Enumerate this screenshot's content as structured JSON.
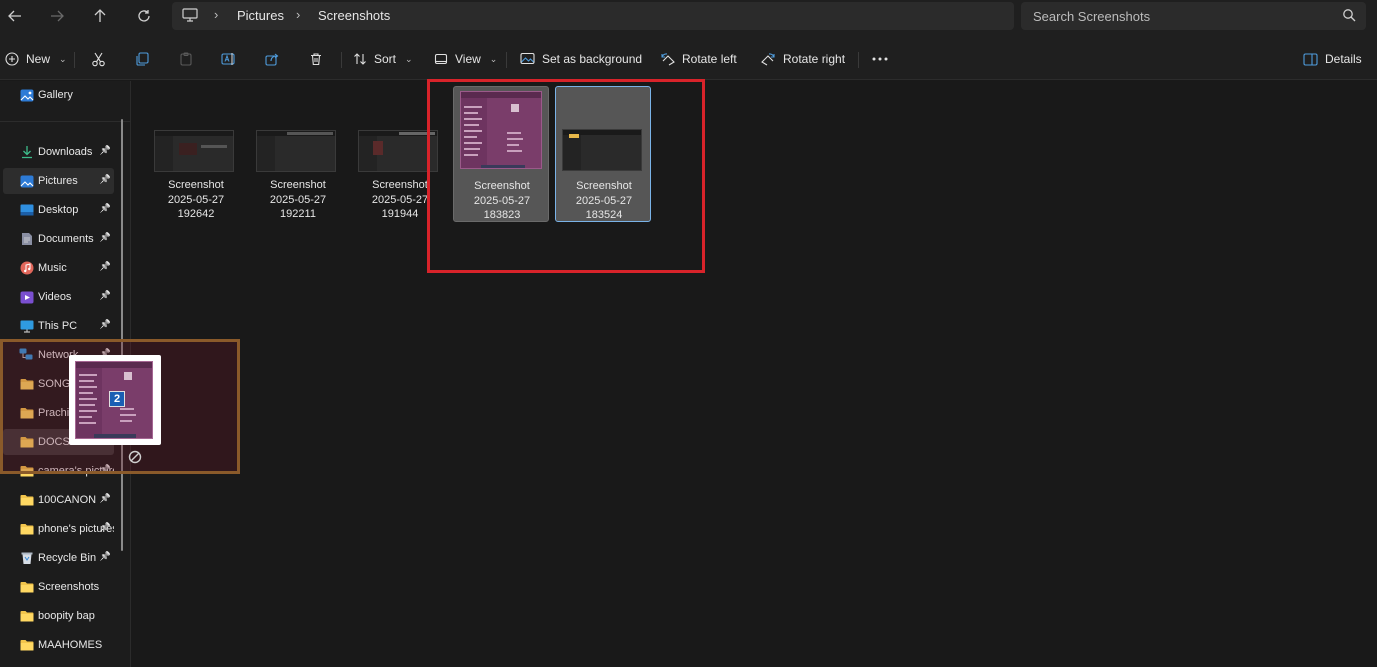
{
  "breadcrumb": [
    "Pictures",
    "Screenshots"
  ],
  "search": {
    "placeholder": "Search Screenshots"
  },
  "commands": {
    "new": "New",
    "sort": "Sort",
    "view": "View",
    "set_background": "Set as background",
    "rotate_left": "Rotate left",
    "rotate_right": "Rotate right",
    "details": "Details"
  },
  "sidebar": {
    "gallery": "Gallery",
    "items": [
      {
        "label": "Downloads",
        "icon": "download-icon",
        "pinned": true
      },
      {
        "label": "Pictures",
        "icon": "pictures-icon",
        "pinned": true,
        "selected": true
      },
      {
        "label": "Desktop",
        "icon": "desktop-icon",
        "pinned": true
      },
      {
        "label": "Documents",
        "icon": "documents-icon",
        "pinned": true
      },
      {
        "label": "Music",
        "icon": "music-icon",
        "pinned": true
      },
      {
        "label": "Videos",
        "icon": "videos-icon",
        "pinned": true
      },
      {
        "label": "This PC",
        "icon": "computer-icon",
        "pinned": true
      },
      {
        "label": "Network",
        "icon": "network-icon",
        "pinned": true
      },
      {
        "label": "SONGS",
        "icon": "folder-icon",
        "pinned": true
      },
      {
        "label": "Prachi",
        "icon": "folder-icon",
        "pinned": true
      },
      {
        "label": "DOCS",
        "icon": "folder-icon",
        "pinned": true,
        "hover": true
      },
      {
        "label": "camera's pictures",
        "icon": "folder-icon",
        "pinned": true
      },
      {
        "label": "100CANON",
        "icon": "folder-icon",
        "pinned": true
      },
      {
        "label": "phone's pictures",
        "icon": "folder-icon",
        "pinned": true
      },
      {
        "label": "Recycle Bin",
        "icon": "recycle-bin-icon",
        "pinned": true
      },
      {
        "label": "Screenshots",
        "icon": "folder-icon",
        "pinned": false
      },
      {
        "label": "boopity bap",
        "icon": "folder-icon",
        "pinned": false
      },
      {
        "label": "MAAHOMES",
        "icon": "folder-icon",
        "pinned": false
      }
    ]
  },
  "files": [
    {
      "name": "Screenshot",
      "date": "2025-05-27",
      "time": "192642",
      "selected": false
    },
    {
      "name": "Screenshot",
      "date": "2025-05-27",
      "time": "192211",
      "selected": false
    },
    {
      "name": "Screenshot",
      "date": "2025-05-27",
      "time": "191944",
      "selected": false
    },
    {
      "name": "Screenshot",
      "date": "2025-05-27",
      "time": "183823",
      "selected": true
    },
    {
      "name": "Screenshot",
      "date": "2025-05-27",
      "time": "183524",
      "selected": true
    }
  ],
  "drag": {
    "count": "2"
  },
  "colors": {
    "annotation_red": "#d8232a",
    "annotation_brown": "#8a5a2a",
    "selection": "#565656",
    "accent": "#1a5fb4"
  }
}
